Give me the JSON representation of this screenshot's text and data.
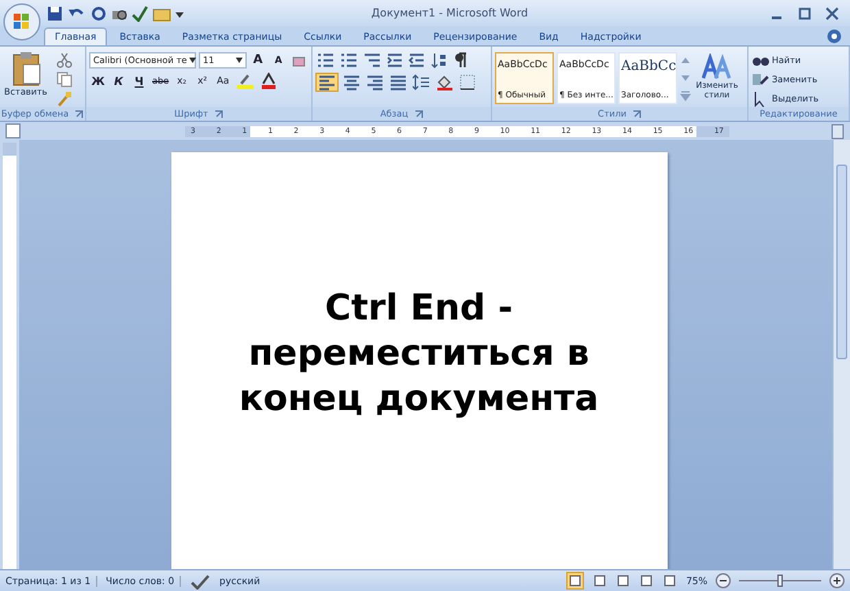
{
  "window": {
    "title": "Документ1 - Microsoft Word"
  },
  "tabs": [
    {
      "label": "Главная",
      "selected": true
    },
    {
      "label": "Вставка",
      "selected": false
    },
    {
      "label": "Разметка страницы",
      "selected": false
    },
    {
      "label": "Ссылки",
      "selected": false
    },
    {
      "label": "Рассылки",
      "selected": false
    },
    {
      "label": "Рецензирование",
      "selected": false
    },
    {
      "label": "Вид",
      "selected": false
    },
    {
      "label": "Надстройки",
      "selected": false
    }
  ],
  "clipboard": {
    "paste_label": "Вставить",
    "group_label": "Буфер обмена"
  },
  "font": {
    "font_name": "Calibri (Основной те",
    "font_size": "11",
    "grow": "A",
    "shrink": "A",
    "format_buttons": [
      "Ж",
      "К",
      "Ч",
      "abe",
      "x₂",
      "x²",
      "Aa"
    ],
    "group_label": "Шрифт"
  },
  "paragraph": {
    "align_buttons": [
      {
        "selected": true
      },
      {
        "selected": false
      },
      {
        "selected": false
      },
      {
        "selected": false
      }
    ],
    "group_label": "Абзац"
  },
  "styles": {
    "items": [
      {
        "preview": "AaBbCcDc",
        "name": "¶ Обычный",
        "selected": true
      },
      {
        "preview": "AaBbCcDc",
        "name": "¶ Без инте...",
        "selected": false
      },
      {
        "preview": "AaBbCc",
        "name": "Заголово...",
        "selected": false
      }
    ],
    "change_styles": "Изменить стили",
    "group_label": "Стили"
  },
  "editing": {
    "items": [
      "Найти",
      "Заменить",
      "Выделить"
    ],
    "group_label": "Редактирование"
  },
  "ruler": {
    "numbers": [
      "3",
      "2",
      "1",
      "1",
      "2",
      "3",
      "4",
      "5",
      "6",
      "7",
      "8",
      "9",
      "10",
      "11",
      "12",
      "13",
      "14",
      "15",
      "16",
      "17"
    ]
  },
  "document": {
    "text": "Ctrl End - переместиться в конец документа"
  },
  "status_bar": {
    "page": "Страница: 1 из 1",
    "words": "Число слов: 0",
    "language": "русский",
    "views": [
      {
        "selected": true
      },
      {
        "selected": false
      },
      {
        "selected": false
      },
      {
        "selected": false
      },
      {
        "selected": false
      }
    ],
    "zoom": "75%",
    "zoom_slider": {
      "level": 0.5
    }
  }
}
